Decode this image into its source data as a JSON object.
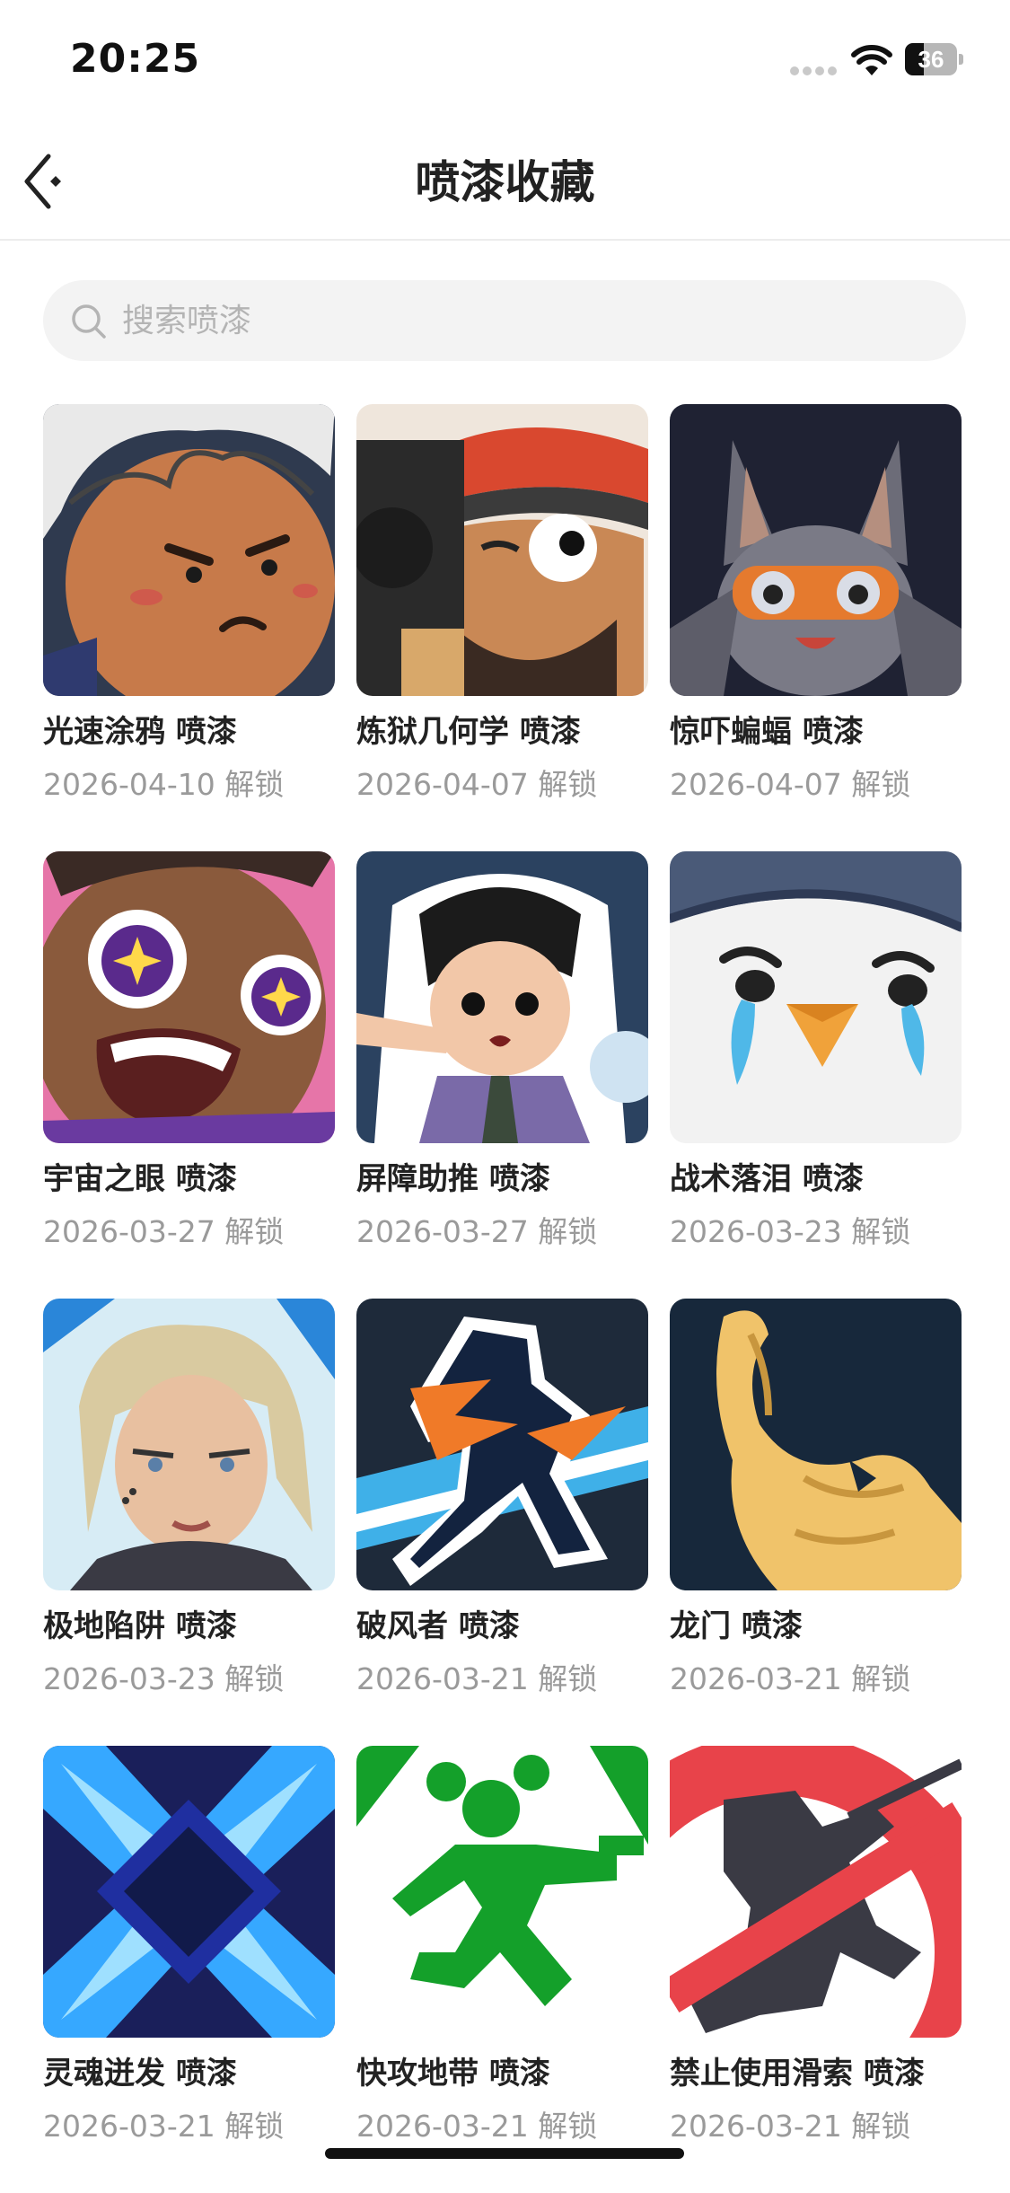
{
  "status_bar": {
    "time": "20:25",
    "battery": "36",
    "battery_level": 0.36
  },
  "nav": {
    "title": "喷漆收藏"
  },
  "search": {
    "placeholder": "搜索喷漆"
  },
  "sprays": [
    {
      "name": "光速涂鸦 喷漆",
      "date": "2026-04-10 解锁"
    },
    {
      "name": "炼狱几何学 喷漆",
      "date": "2026-04-07 解锁"
    },
    {
      "name": "惊吓蝙蝠 喷漆",
      "date": "2026-04-07 解锁"
    },
    {
      "name": "宇宙之眼 喷漆",
      "date": "2026-03-27 解锁"
    },
    {
      "name": "屏障助推 喷漆",
      "date": "2026-03-27 解锁"
    },
    {
      "name": "战术落泪 喷漆",
      "date": "2026-03-23 解锁"
    },
    {
      "name": "极地陷阱 喷漆",
      "date": "2026-03-23 解锁"
    },
    {
      "name": "破风者 喷漆",
      "date": "2026-03-21 解锁"
    },
    {
      "name": "龙门 喷漆",
      "date": "2026-03-21 解锁"
    },
    {
      "name": "灵魂迸发 喷漆",
      "date": "2026-03-21 解锁"
    },
    {
      "name": "快攻地带 喷漆",
      "date": "2026-03-21 解锁"
    },
    {
      "name": "禁止使用滑索 喷漆",
      "date": "2026-03-21 解锁"
    }
  ]
}
